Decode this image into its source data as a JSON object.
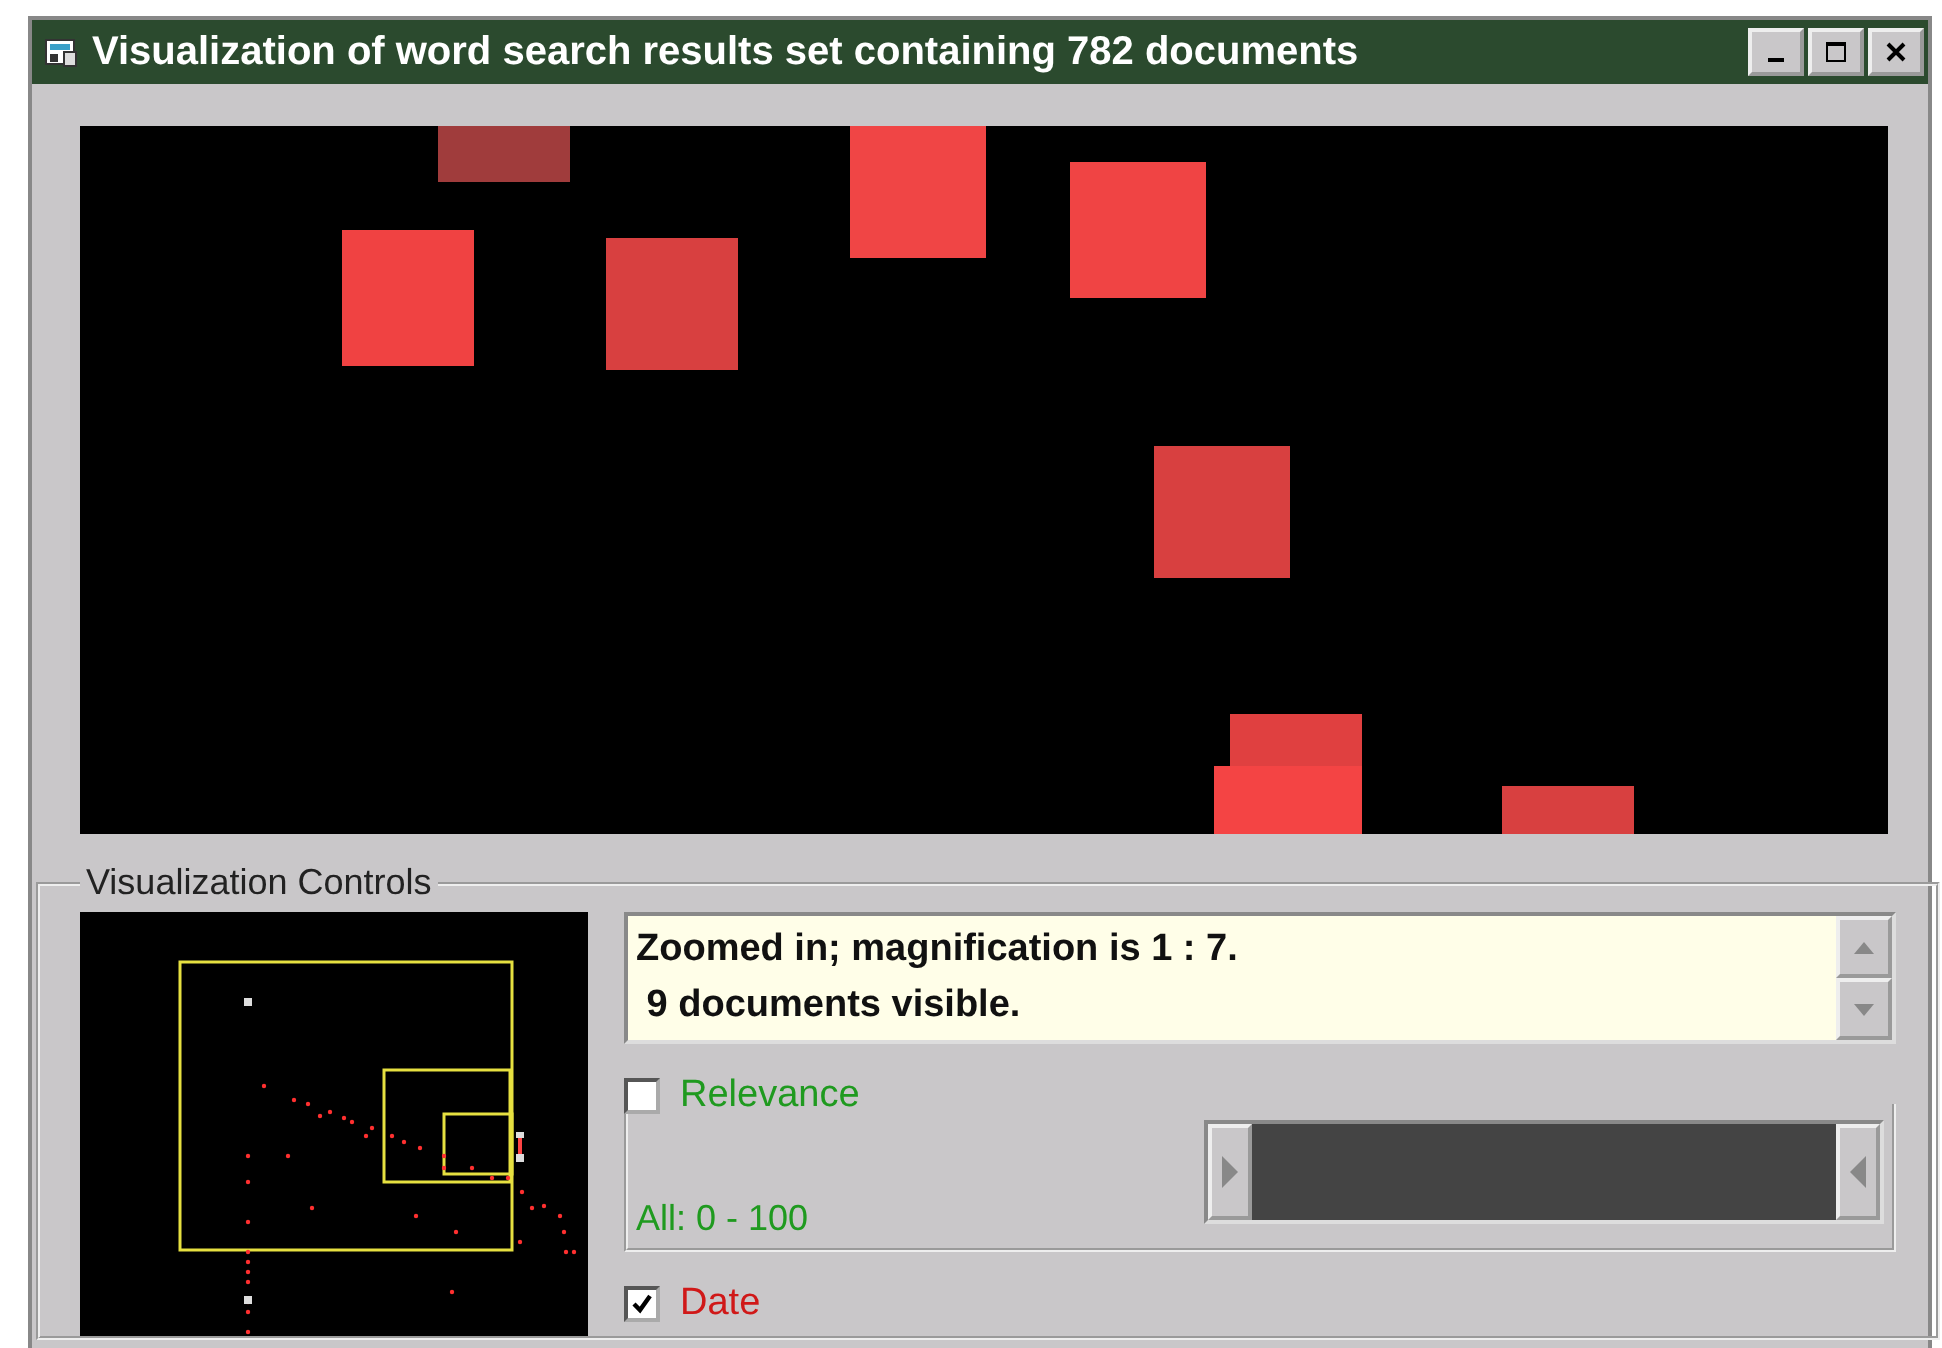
{
  "window": {
    "title": "Visualization of word search results set containing 782 documents",
    "buttons": [
      {
        "kind": "minimize"
      },
      {
        "kind": "maximize"
      },
      {
        "kind": "close"
      }
    ]
  },
  "controls": {
    "title": "Visualization Controls",
    "message": {
      "lines": [
        "Zoomed in; magnification is 1 : 7.",
        " 9 documents visible."
      ]
    },
    "filters": [
      {
        "label": "Relevance",
        "checked": false,
        "color": "#1f9a1f",
        "range_text": "All: 0 - 100",
        "level": 1
      },
      {
        "label": "Date",
        "checked": true,
        "color": "#d01818"
      }
    ]
  }
}
